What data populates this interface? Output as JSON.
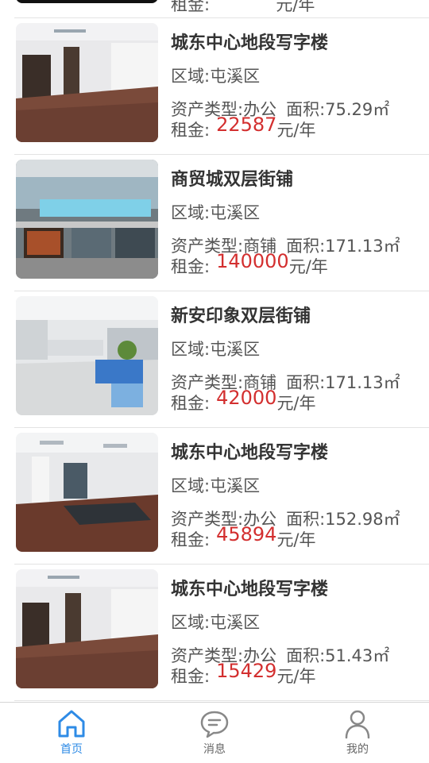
{
  "listings": [
    {
      "title": "城东中心地段写字楼",
      "area_label": "区域:屯溪区",
      "type_label": "资产类型:办公",
      "size_label": "面积:75.29㎡",
      "rent_prefix": "租金:",
      "price": "22587",
      "rent_suffix": "元/年"
    },
    {
      "title": "商贸城双层街铺",
      "area_label": "区域:屯溪区",
      "type_label": "资产类型:商铺",
      "size_label": "面积:171.13㎡",
      "rent_prefix": "租金:",
      "price": "140000",
      "rent_suffix": "元/年"
    },
    {
      "title": "新安印象双层街铺",
      "area_label": "区域:屯溪区",
      "type_label": "资产类型:商铺",
      "size_label": "面积:171.13㎡",
      "rent_prefix": "租金:",
      "price": "42000",
      "rent_suffix": "元/年"
    },
    {
      "title": "城东中心地段写字楼",
      "area_label": "区域:屯溪区",
      "type_label": "资产类型:办公",
      "size_label": "面积:152.98㎡",
      "rent_prefix": "租金:",
      "price": "45894",
      "rent_suffix": "元/年"
    },
    {
      "title": "城东中心地段写字楼",
      "area_label": "区域:屯溪区",
      "type_label": "资产类型:办公",
      "size_label": "面积:51.43㎡",
      "rent_prefix": "租金:",
      "price": "15429",
      "rent_suffix": "元/年"
    }
  ],
  "partial_top": {
    "rent_prefix": "租金:",
    "rent_suffix": "元/年"
  },
  "tabs": [
    {
      "label": "首页",
      "icon": "home-icon",
      "active": true
    },
    {
      "label": "消息",
      "icon": "chat-bubble-icon",
      "active": false
    },
    {
      "label": "我的",
      "icon": "user-icon",
      "active": false
    }
  ],
  "colors": {
    "accent": "#2e8be6",
    "price": "#d32f2f"
  }
}
